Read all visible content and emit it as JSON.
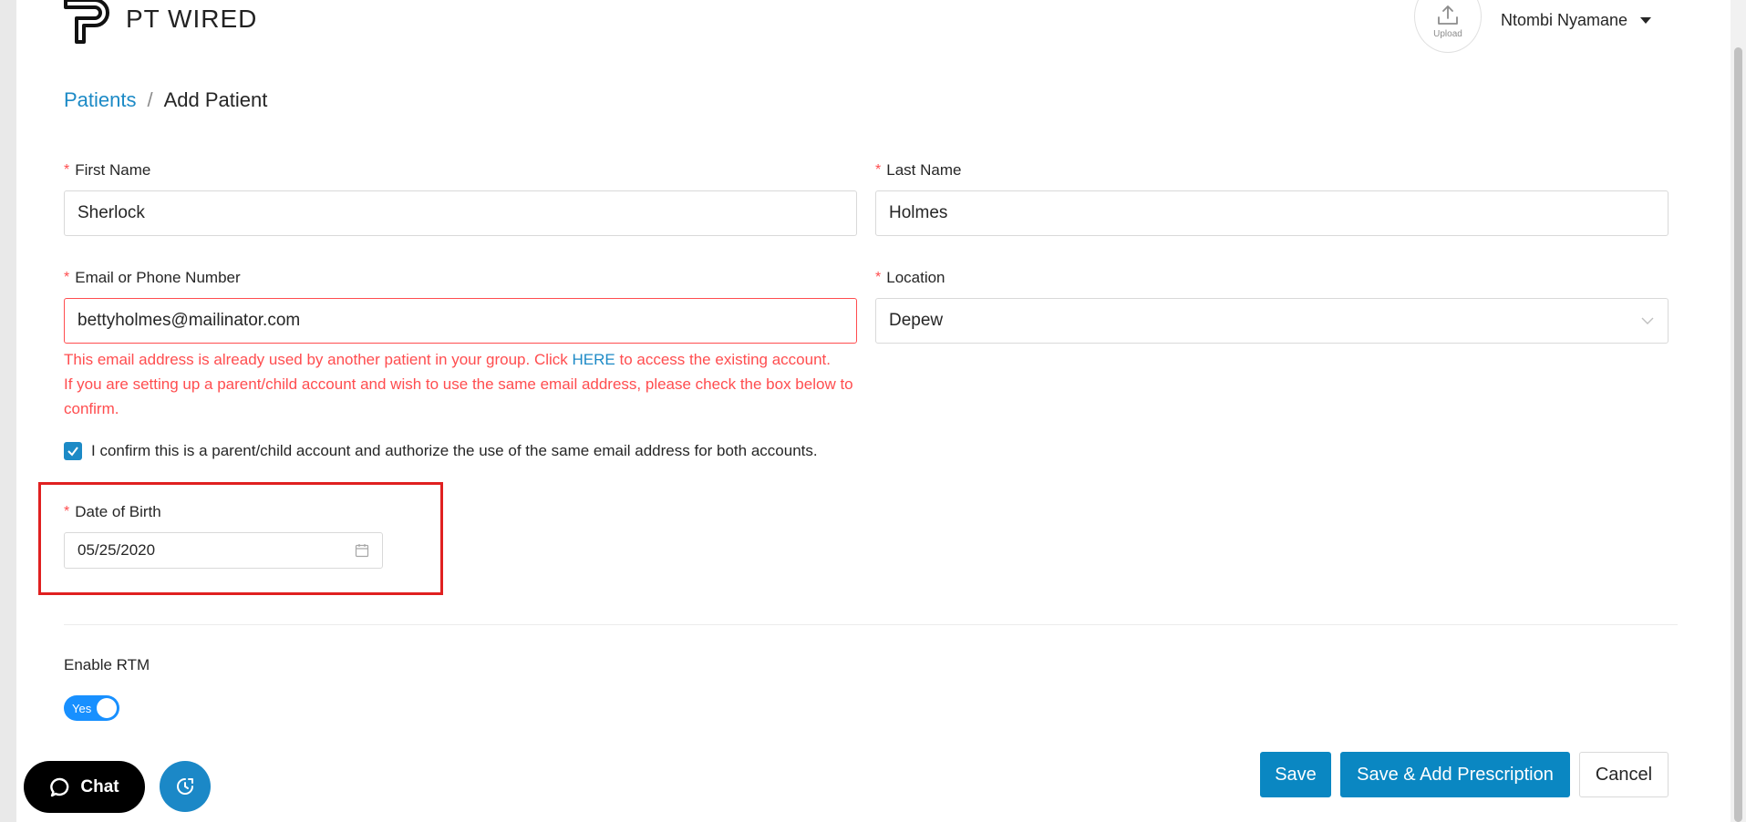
{
  "header": {
    "brand": "PT WIRED",
    "upload_label": "Upload",
    "user_name": "Ntombi Nyamane"
  },
  "breadcrumb": {
    "parent": "Patients",
    "separator": "/",
    "current": "Add Patient"
  },
  "form": {
    "required_mark": "*",
    "first_name": {
      "label": "First Name",
      "value": "Sherlock"
    },
    "last_name": {
      "label": "Last Name",
      "value": "Holmes"
    },
    "email": {
      "label": "Email or Phone Number",
      "value": "bettyholmes@mailinator.com",
      "error_line1_before": "This email address is already used by another patient in your group. Click ",
      "error_link": "HERE",
      "error_line1_after": " to access the existing account.",
      "error_line2": "If you are setting up a parent/child account and wish to use the same email address, please check the box below to confirm."
    },
    "location": {
      "label": "Location",
      "value": "Depew"
    },
    "confirm_checkbox": {
      "checked": true,
      "label": "I confirm this is a parent/child account and authorize the use of the same email address for both accounts."
    },
    "dob": {
      "label": "Date of Birth",
      "value": "05/25/2020"
    },
    "rtm": {
      "label": "Enable RTM",
      "toggle_label": "Yes",
      "enabled": true
    }
  },
  "actions": {
    "save": "Save",
    "save_add_prescription": "Save & Add Prescription",
    "cancel": "Cancel"
  },
  "widgets": {
    "chat_label": "Chat"
  },
  "colors": {
    "accent": "#0a87c2",
    "link": "#1c8ac6",
    "error": "#ff4d4f",
    "highlight": "#e02020",
    "toggle_on": "#1890ff"
  }
}
